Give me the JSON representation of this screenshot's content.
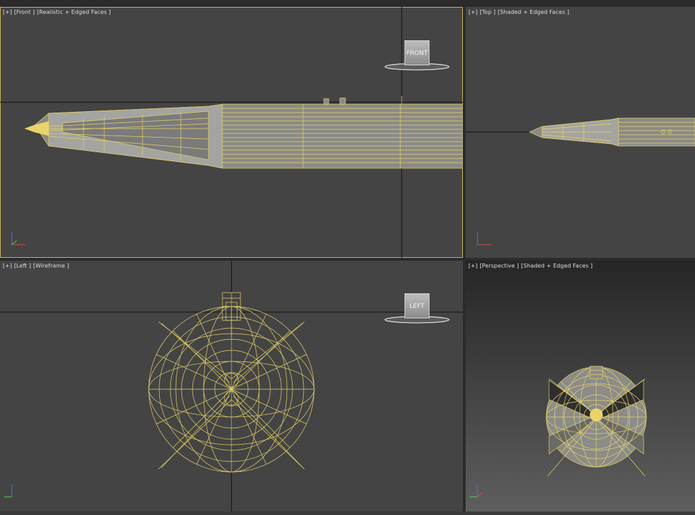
{
  "viewports": {
    "front": {
      "menu": "[+]",
      "view": "[Front ]",
      "shading": "[Realistic + Edged Faces ]",
      "cube": "FRONT"
    },
    "top": {
      "menu": "[+]",
      "view": "[Top ]",
      "shading": "[Shaded + Edged Faces ]"
    },
    "left": {
      "menu": "[+]",
      "view": "[Left ]",
      "shading": "[Wireframe ]",
      "cube": "LEFT"
    },
    "perspective": {
      "menu": "[+]",
      "view": "[Perspective ]",
      "shading": "[Shaded + Edged Faces ]"
    }
  },
  "axis_labels": {
    "z": "z",
    "x": "x",
    "y": "y"
  },
  "colors": {
    "viewport_bg": "#444444",
    "wire": "#e8d46a",
    "active_border": "#c9b45a",
    "gap": "#2b2b2b"
  }
}
